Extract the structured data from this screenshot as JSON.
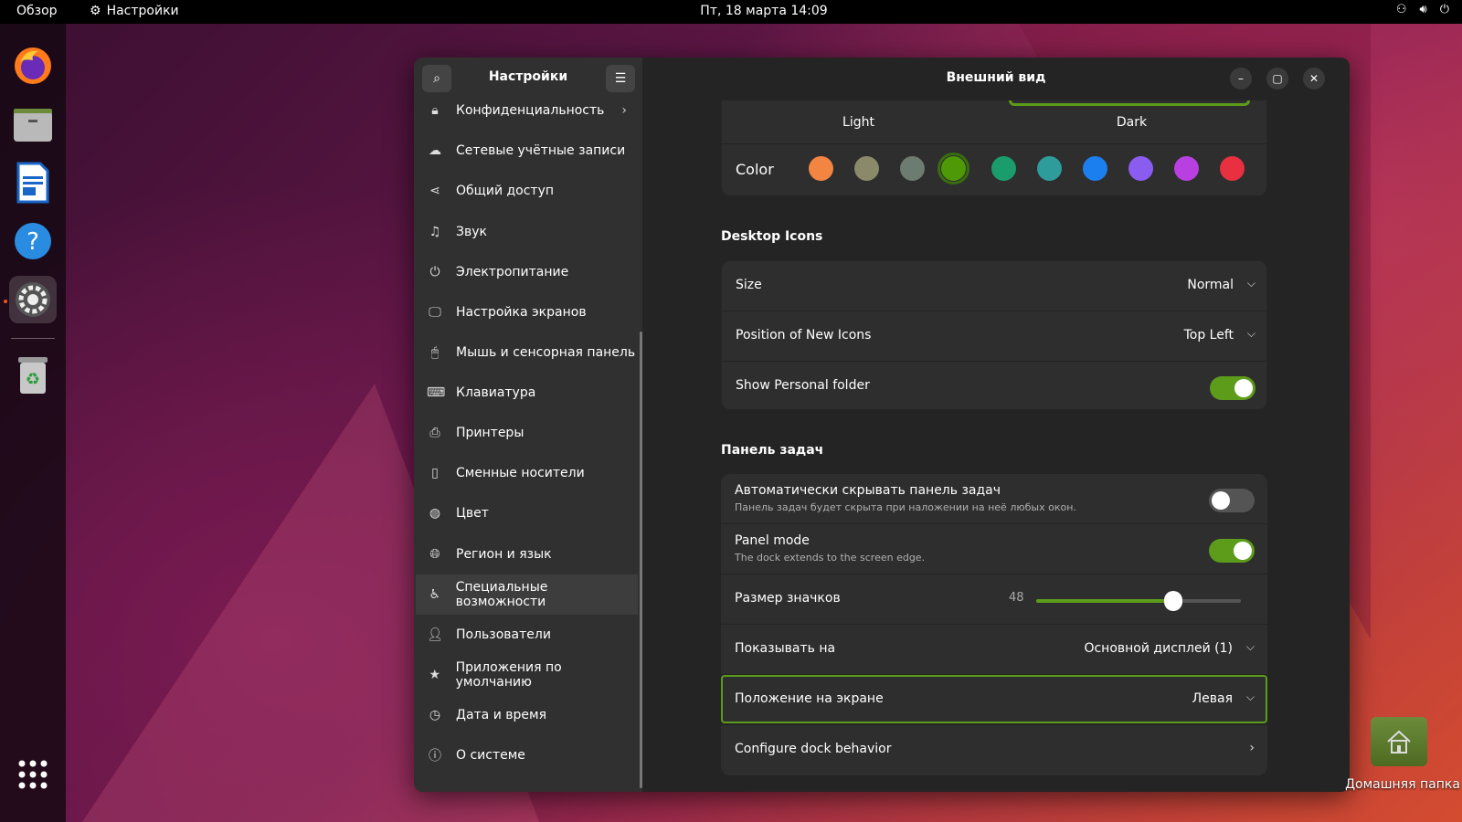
{
  "topbar": {
    "overview": "Обзор",
    "app_name": "Настройки",
    "clock": "Пт, 18 марта  14:09"
  },
  "dock": {
    "items": [
      "firefox-icon",
      "files-icon",
      "writer-icon",
      "help-icon",
      "settings-icon",
      "trash-icon",
      "app-grid-icon"
    ]
  },
  "sidebar": {
    "title": "Настройки",
    "items": [
      {
        "label": "Конфиденциальность",
        "icon": "lock"
      },
      {
        "label": "Сетевые учётные записи",
        "icon": "cloud"
      },
      {
        "label": "Общий доступ",
        "icon": "share"
      },
      {
        "label": "Звук",
        "icon": "music-note"
      },
      {
        "label": "Электропитание",
        "icon": "power"
      },
      {
        "label": "Настройка экранов",
        "icon": "monitor"
      },
      {
        "label": "Мышь и сенсорная панель",
        "icon": "mouse"
      },
      {
        "label": "Клавиатура",
        "icon": "keyboard"
      },
      {
        "label": "Принтеры",
        "icon": "printer"
      },
      {
        "label": "Сменные носители",
        "icon": "usb"
      },
      {
        "label": "Цвет",
        "icon": "color"
      },
      {
        "label": "Регион и язык",
        "icon": "globe"
      },
      {
        "label": "Специальные возможности",
        "icon": "accessibility"
      },
      {
        "label": "Пользователи",
        "icon": "users"
      },
      {
        "label": "Приложения по умолчанию",
        "icon": "star"
      },
      {
        "label": "Дата и время",
        "icon": "clock"
      },
      {
        "label": "О системе",
        "icon": "info"
      }
    ]
  },
  "content": {
    "title": "Внешний вид",
    "style": {
      "light": "Light",
      "dark": "Dark",
      "color_label": "Color"
    },
    "colors": [
      "#f28542",
      "#8a8a6a",
      "#6c7c70",
      "#4e9a06",
      "#1a9c6c",
      "#2f9c9c",
      "#1c7ff0",
      "#8a5cf0",
      "#b940e0",
      "#e83040"
    ],
    "desktop_icons": {
      "section": "Desktop Icons",
      "size_label": "Size",
      "size_value": "Normal",
      "position_label": "Position of New Icons",
      "position_value": "Top Left",
      "personal_label": "Show Personal folder",
      "personal_on": true
    },
    "dock": {
      "section": "Панель задач",
      "autohide_label": "Автоматически скрывать панель задач",
      "autohide_sub": "Панель задач будет скрыта при наложении на неё любых окон.",
      "autohide_on": false,
      "panel_label": "Panel mode",
      "panel_sub": "The dock extends to the screen edge.",
      "panel_on": true,
      "icon_size_label": "Размер значков",
      "icon_size_value": "48",
      "icon_size_fraction": 0.67,
      "show_on_label": "Показывать на",
      "show_on_value": "Основной дисплей (1)",
      "position_label": "Положение на экране",
      "position_value": "Левая",
      "configure_label": "Configure dock behavior"
    }
  },
  "desktop": {
    "home_folder_label": "Домашняя папка"
  },
  "accent": "#5c9c1a"
}
